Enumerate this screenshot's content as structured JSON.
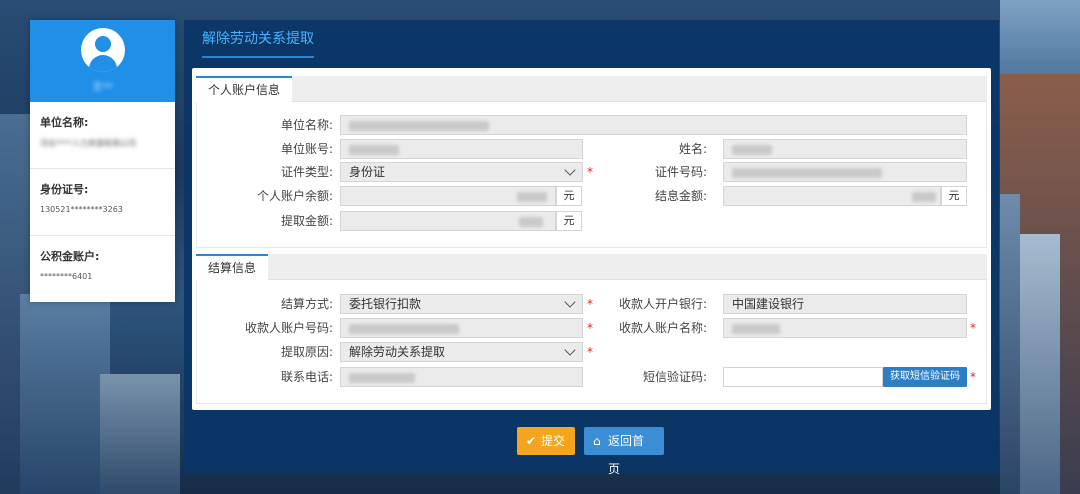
{
  "user": {
    "name": "王**",
    "fields": [
      {
        "label": "单位名称:",
        "value": "河北****人力资源有限公司"
      },
      {
        "label": "身份证号:",
        "value": "130521********3263"
      },
      {
        "label": "公积金账户:",
        "value": "********6401"
      }
    ]
  },
  "page_title": "解除劳动关系提取",
  "personal": {
    "section_title": "个人账户信息",
    "unit_name_label": "单位名称:",
    "unit_account_label": "单位账号:",
    "name_label": "姓名:",
    "id_type_label": "证件类型:",
    "id_type_value": "身份证",
    "id_number_label": "证件号码:",
    "balance_label": "个人账户余额:",
    "interest_label": "结息金额:",
    "withdraw_label": "提取金额:",
    "unit": "元"
  },
  "settlement": {
    "section_title": "结算信息",
    "method_label": "结算方式:",
    "method_value": "委托银行扣款",
    "bank_label": "收款人开户银行:",
    "bank_value": "中国建设银行",
    "account_no_label": "收款人账户号码:",
    "account_name_label": "收款人账户名称:",
    "reason_label": "提取原因:",
    "reason_value": "解除劳动关系提取",
    "phone_label": "联系电话:",
    "sms_label": "短信验证码:",
    "sms_button": "获取短信验证码"
  },
  "required_mark": "*",
  "actions": {
    "submit": "提交",
    "home": "返回首页"
  },
  "colors": {
    "brand_blue": "#1f8fe8",
    "panel": "#083466",
    "submit": "#f3a51d",
    "home": "#3b8ed6",
    "required": "#e02424"
  }
}
